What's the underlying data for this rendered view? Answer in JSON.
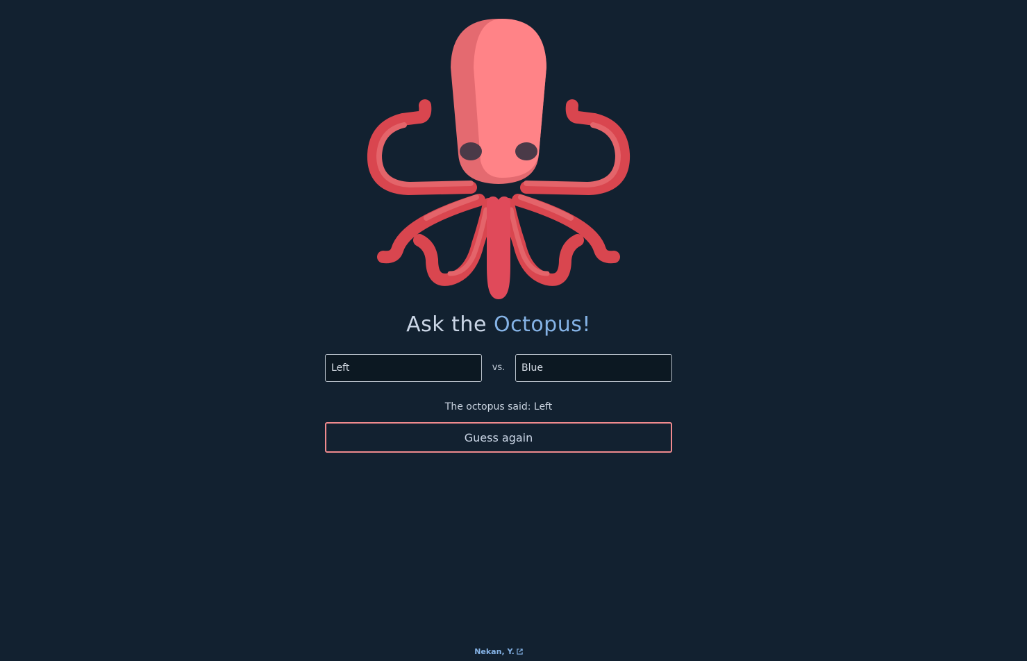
{
  "title": {
    "prefix": "Ask the",
    "accent": "Octopus!"
  },
  "inputs": {
    "left_value": "Left",
    "right_value": "Blue",
    "separator": "vs."
  },
  "result": {
    "text": "The octopus said: Left"
  },
  "actions": {
    "guess_again_label": "Guess again"
  },
  "footer": {
    "author_link": "Nekan, Y.",
    "author_link_icon": "external-link-icon"
  },
  "colors": {
    "background": "#122130",
    "octopus_body": "#ff7f82",
    "octopus_shade": "#e46a70",
    "octopus_tentacle_dark": "#e04a5a",
    "accent_blue": "#85b3e6",
    "button_border": "#f08a8e",
    "eyes": "#4a3a48"
  }
}
